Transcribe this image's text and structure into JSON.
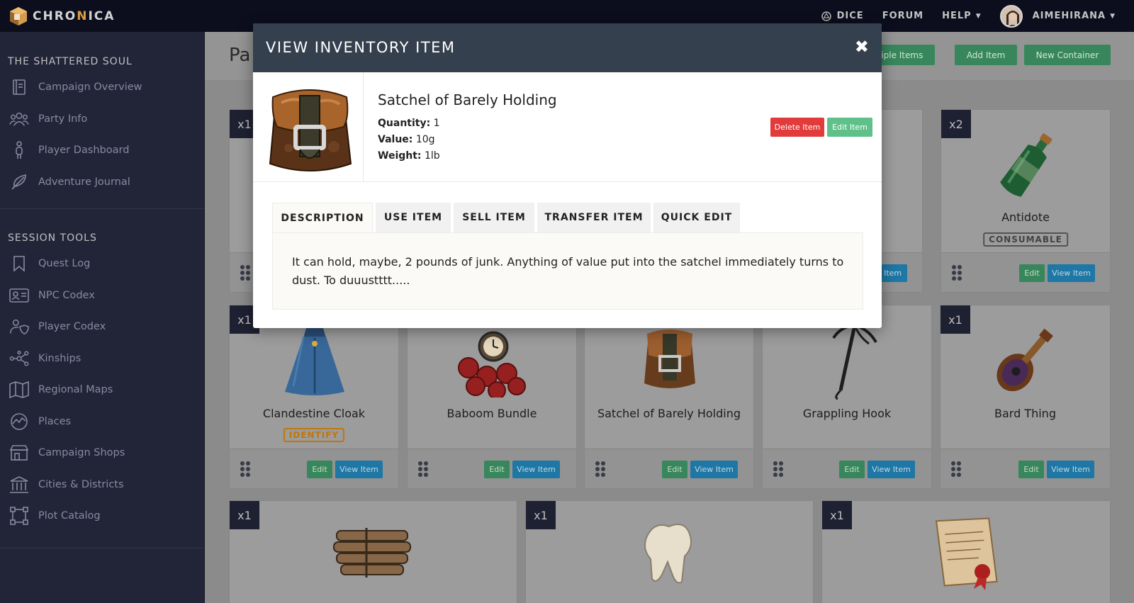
{
  "header": {
    "brand_prefix": "CHRO",
    "brand_highlight": "N",
    "brand_suffix": "ICA",
    "nav": {
      "dice": "DICE",
      "forum": "FORUM",
      "help": "HELP",
      "user": "AIMEHIRANA"
    }
  },
  "sidebar": {
    "campaign_title": "THE SHATTERED SOUL",
    "campaign_items": [
      {
        "label": "Campaign Overview",
        "icon": "book-icon"
      },
      {
        "label": "Party Info",
        "icon": "group-icon"
      },
      {
        "label": "Player Dashboard",
        "icon": "person-icon"
      },
      {
        "label": "Adventure Journal",
        "icon": "feather-icon"
      }
    ],
    "tools_title": "SESSION TOOLS",
    "tool_items": [
      {
        "label": "Quest Log",
        "icon": "bookmark-icon"
      },
      {
        "label": "NPC Codex",
        "icon": "id-card-icon"
      },
      {
        "label": "Player Codex",
        "icon": "user-shield-icon"
      },
      {
        "label": "Kinships",
        "icon": "network-icon"
      },
      {
        "label": "Regional Maps",
        "icon": "map-icon"
      },
      {
        "label": "Places",
        "icon": "location-icon"
      },
      {
        "label": "Campaign Shops",
        "icon": "store-icon"
      },
      {
        "label": "Cities & Districts",
        "icon": "landmark-icon"
      },
      {
        "label": "Plot Catalog",
        "icon": "nodes-icon"
      }
    ]
  },
  "main": {
    "page_title": "Pa",
    "buttons": {
      "multiple": "ultiple Items",
      "add": "Add Item",
      "container": "New Container"
    },
    "card_buttons": {
      "edit": "Edit",
      "view": "View Item"
    },
    "cards_row1": [
      {
        "qty": "x1"
      },
      {
        "partial_name": "n",
        "partial_view": "ew Item"
      },
      {
        "qty": "x2",
        "name": "Antidote",
        "tag": "CONSUMABLE"
      }
    ],
    "cards_row2": [
      {
        "qty": "x1",
        "name": "Clandestine Cloak",
        "tag": "IDENTIFY"
      },
      {
        "name": "Baboom Bundle"
      },
      {
        "name": "Satchel of Barely Holding"
      },
      {
        "name": "Grappling Hook"
      },
      {
        "qty": "x1",
        "name": "Bard Thing"
      }
    ],
    "cards_row3": [
      {
        "qty": "x1"
      },
      {
        "qty": "x1"
      },
      {
        "qty": "x1"
      }
    ]
  },
  "modal": {
    "title": "VIEW INVENTORY ITEM",
    "close": "✖",
    "item_name": "Satchel of Barely Holding",
    "quantity_label": "Quantity:",
    "quantity": "1",
    "value_label": "Value:",
    "value": "10g",
    "weight_label": "Weight:",
    "weight": "1lb",
    "delete_label": "Delete Item",
    "edit_label": "Edit Item",
    "tabs": [
      "DESCRIPTION",
      "USE ITEM",
      "SELL ITEM",
      "TRANSFER ITEM",
      "QUICK EDIT"
    ],
    "description": "It can hold, maybe, 2 pounds of junk. Anything of value put into the satchel immediately turns to dust. To duuustttt....."
  },
  "colors": {
    "accent_green": "#3a8a5e",
    "accent_blue": "#1f7aa8",
    "danger": "#e23b3b",
    "modal_header": "#34404d"
  }
}
